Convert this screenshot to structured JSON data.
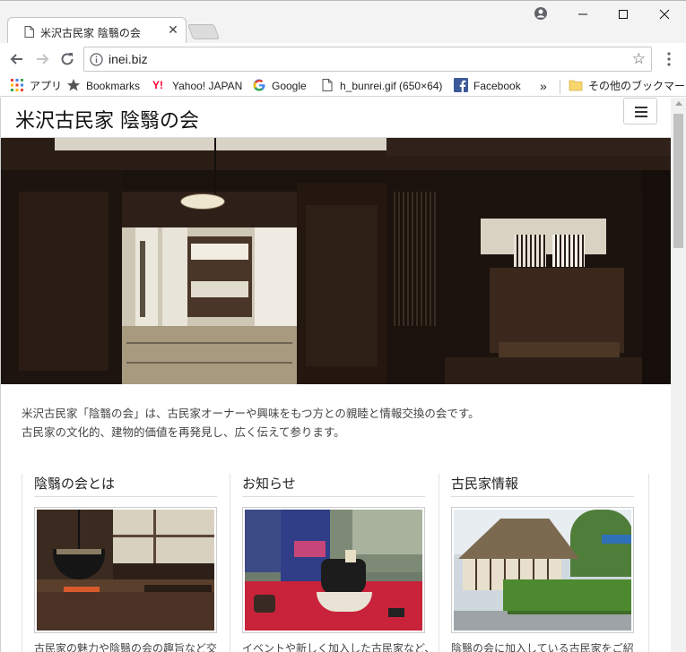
{
  "browser": {
    "tab_title": "米沢古民家 陰翳の会",
    "url": "inei.biz",
    "bookmarks": [
      {
        "label": "アプリ",
        "icon": "apps-grid-icon"
      },
      {
        "label": "Bookmarks",
        "icon": "star-icon"
      },
      {
        "label": "Yahoo! JAPAN",
        "icon": "yahoo-icon"
      },
      {
        "label": "Google",
        "icon": "google-icon"
      },
      {
        "label": "h_bunrei.gif (650×64)",
        "icon": "document-icon"
      },
      {
        "label": "Facebook",
        "icon": "facebook-icon"
      }
    ],
    "more_bookmarks": "»",
    "other_bookmarks": "その他のブックマーク"
  },
  "site": {
    "title": "米沢古民家 陰翳の会",
    "intro_line1": "米沢古民家「陰翳の会」は、古民家オーナーや興味をもつ方との親睦と情報交換の会です。",
    "intro_line2": "古民家の文化的、建物的価値を再発見し、広く伝えて参ります。",
    "columns": [
      {
        "heading": "陰翳の会とは",
        "excerpt": "古民家の魅力や陰翳の会の趣旨など交"
      },
      {
        "heading": "お知らせ",
        "excerpt": "イベントや新しく加入した古民家など、新"
      },
      {
        "heading": "古民家情報",
        "excerpt": "陰翳の会に加入している古民家をご紹"
      }
    ]
  },
  "colors": {
    "facebook": "#3b5998",
    "yahoo": "#ff0033",
    "folder": "#f7d66b"
  }
}
